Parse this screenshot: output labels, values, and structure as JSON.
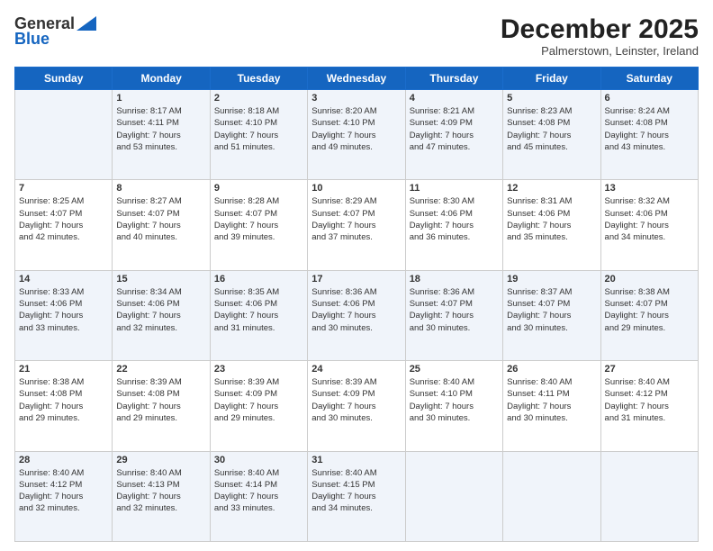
{
  "header": {
    "logo_line1": "General",
    "logo_line2": "Blue",
    "month": "December 2025",
    "location": "Palmerstown, Leinster, Ireland"
  },
  "days_of_week": [
    "Sunday",
    "Monday",
    "Tuesday",
    "Wednesday",
    "Thursday",
    "Friday",
    "Saturday"
  ],
  "weeks": [
    [
      {
        "day": "",
        "info": ""
      },
      {
        "day": "1",
        "info": "Sunrise: 8:17 AM\nSunset: 4:11 PM\nDaylight: 7 hours\nand 53 minutes."
      },
      {
        "day": "2",
        "info": "Sunrise: 8:18 AM\nSunset: 4:10 PM\nDaylight: 7 hours\nand 51 minutes."
      },
      {
        "day": "3",
        "info": "Sunrise: 8:20 AM\nSunset: 4:10 PM\nDaylight: 7 hours\nand 49 minutes."
      },
      {
        "day": "4",
        "info": "Sunrise: 8:21 AM\nSunset: 4:09 PM\nDaylight: 7 hours\nand 47 minutes."
      },
      {
        "day": "5",
        "info": "Sunrise: 8:23 AM\nSunset: 4:08 PM\nDaylight: 7 hours\nand 45 minutes."
      },
      {
        "day": "6",
        "info": "Sunrise: 8:24 AM\nSunset: 4:08 PM\nDaylight: 7 hours\nand 43 minutes."
      }
    ],
    [
      {
        "day": "7",
        "info": "Sunrise: 8:25 AM\nSunset: 4:07 PM\nDaylight: 7 hours\nand 42 minutes."
      },
      {
        "day": "8",
        "info": "Sunrise: 8:27 AM\nSunset: 4:07 PM\nDaylight: 7 hours\nand 40 minutes."
      },
      {
        "day": "9",
        "info": "Sunrise: 8:28 AM\nSunset: 4:07 PM\nDaylight: 7 hours\nand 39 minutes."
      },
      {
        "day": "10",
        "info": "Sunrise: 8:29 AM\nSunset: 4:07 PM\nDaylight: 7 hours\nand 37 minutes."
      },
      {
        "day": "11",
        "info": "Sunrise: 8:30 AM\nSunset: 4:06 PM\nDaylight: 7 hours\nand 36 minutes."
      },
      {
        "day": "12",
        "info": "Sunrise: 8:31 AM\nSunset: 4:06 PM\nDaylight: 7 hours\nand 35 minutes."
      },
      {
        "day": "13",
        "info": "Sunrise: 8:32 AM\nSunset: 4:06 PM\nDaylight: 7 hours\nand 34 minutes."
      }
    ],
    [
      {
        "day": "14",
        "info": "Sunrise: 8:33 AM\nSunset: 4:06 PM\nDaylight: 7 hours\nand 33 minutes."
      },
      {
        "day": "15",
        "info": "Sunrise: 8:34 AM\nSunset: 4:06 PM\nDaylight: 7 hours\nand 32 minutes."
      },
      {
        "day": "16",
        "info": "Sunrise: 8:35 AM\nSunset: 4:06 PM\nDaylight: 7 hours\nand 31 minutes."
      },
      {
        "day": "17",
        "info": "Sunrise: 8:36 AM\nSunset: 4:06 PM\nDaylight: 7 hours\nand 30 minutes."
      },
      {
        "day": "18",
        "info": "Sunrise: 8:36 AM\nSunset: 4:07 PM\nDaylight: 7 hours\nand 30 minutes."
      },
      {
        "day": "19",
        "info": "Sunrise: 8:37 AM\nSunset: 4:07 PM\nDaylight: 7 hours\nand 30 minutes."
      },
      {
        "day": "20",
        "info": "Sunrise: 8:38 AM\nSunset: 4:07 PM\nDaylight: 7 hours\nand 29 minutes."
      }
    ],
    [
      {
        "day": "21",
        "info": "Sunrise: 8:38 AM\nSunset: 4:08 PM\nDaylight: 7 hours\nand 29 minutes."
      },
      {
        "day": "22",
        "info": "Sunrise: 8:39 AM\nSunset: 4:08 PM\nDaylight: 7 hours\nand 29 minutes."
      },
      {
        "day": "23",
        "info": "Sunrise: 8:39 AM\nSunset: 4:09 PM\nDaylight: 7 hours\nand 29 minutes."
      },
      {
        "day": "24",
        "info": "Sunrise: 8:39 AM\nSunset: 4:09 PM\nDaylight: 7 hours\nand 30 minutes."
      },
      {
        "day": "25",
        "info": "Sunrise: 8:40 AM\nSunset: 4:10 PM\nDaylight: 7 hours\nand 30 minutes."
      },
      {
        "day": "26",
        "info": "Sunrise: 8:40 AM\nSunset: 4:11 PM\nDaylight: 7 hours\nand 30 minutes."
      },
      {
        "day": "27",
        "info": "Sunrise: 8:40 AM\nSunset: 4:12 PM\nDaylight: 7 hours\nand 31 minutes."
      }
    ],
    [
      {
        "day": "28",
        "info": "Sunrise: 8:40 AM\nSunset: 4:12 PM\nDaylight: 7 hours\nand 32 minutes."
      },
      {
        "day": "29",
        "info": "Sunrise: 8:40 AM\nSunset: 4:13 PM\nDaylight: 7 hours\nand 32 minutes."
      },
      {
        "day": "30",
        "info": "Sunrise: 8:40 AM\nSunset: 4:14 PM\nDaylight: 7 hours\nand 33 minutes."
      },
      {
        "day": "31",
        "info": "Sunrise: 8:40 AM\nSunset: 4:15 PM\nDaylight: 7 hours\nand 34 minutes."
      },
      {
        "day": "",
        "info": ""
      },
      {
        "day": "",
        "info": ""
      },
      {
        "day": "",
        "info": ""
      }
    ]
  ]
}
